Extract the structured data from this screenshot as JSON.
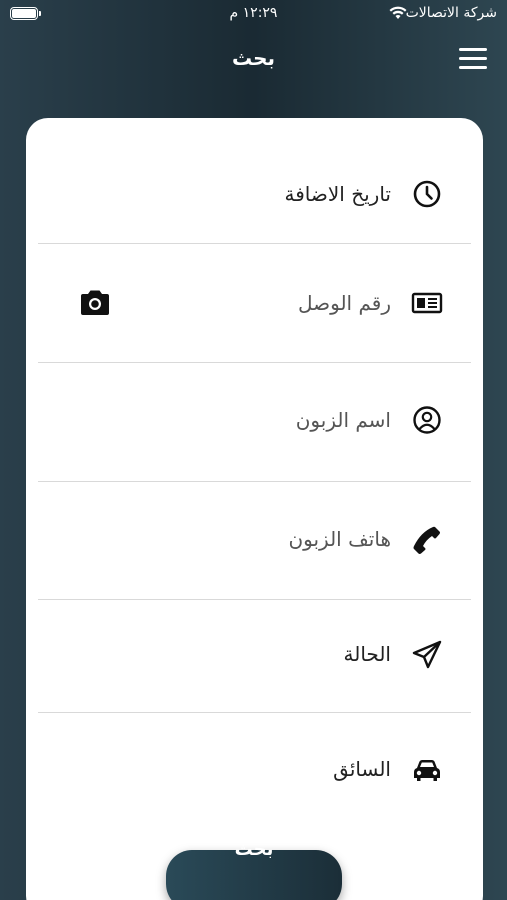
{
  "status_bar": {
    "time": "١٢:٢٩ م",
    "carrier": "شركة الاتصالات"
  },
  "header": {
    "title": "بحث"
  },
  "form": {
    "fields": [
      {
        "label": "تاريخ الاضافة",
        "icon": "clock-icon"
      },
      {
        "label": "رقم الوصل",
        "icon": "receipt-card-icon",
        "action_icon": "camera-icon"
      },
      {
        "label": "اسم الزبون",
        "icon": "user-circle-icon"
      },
      {
        "label": "هاتف الزبون",
        "icon": "phone-icon"
      },
      {
        "label": "الحالة",
        "icon": "paper-plane-icon"
      },
      {
        "label": "السائق",
        "icon": "car-icon"
      }
    ]
  },
  "search_button": {
    "label": "بحث"
  }
}
